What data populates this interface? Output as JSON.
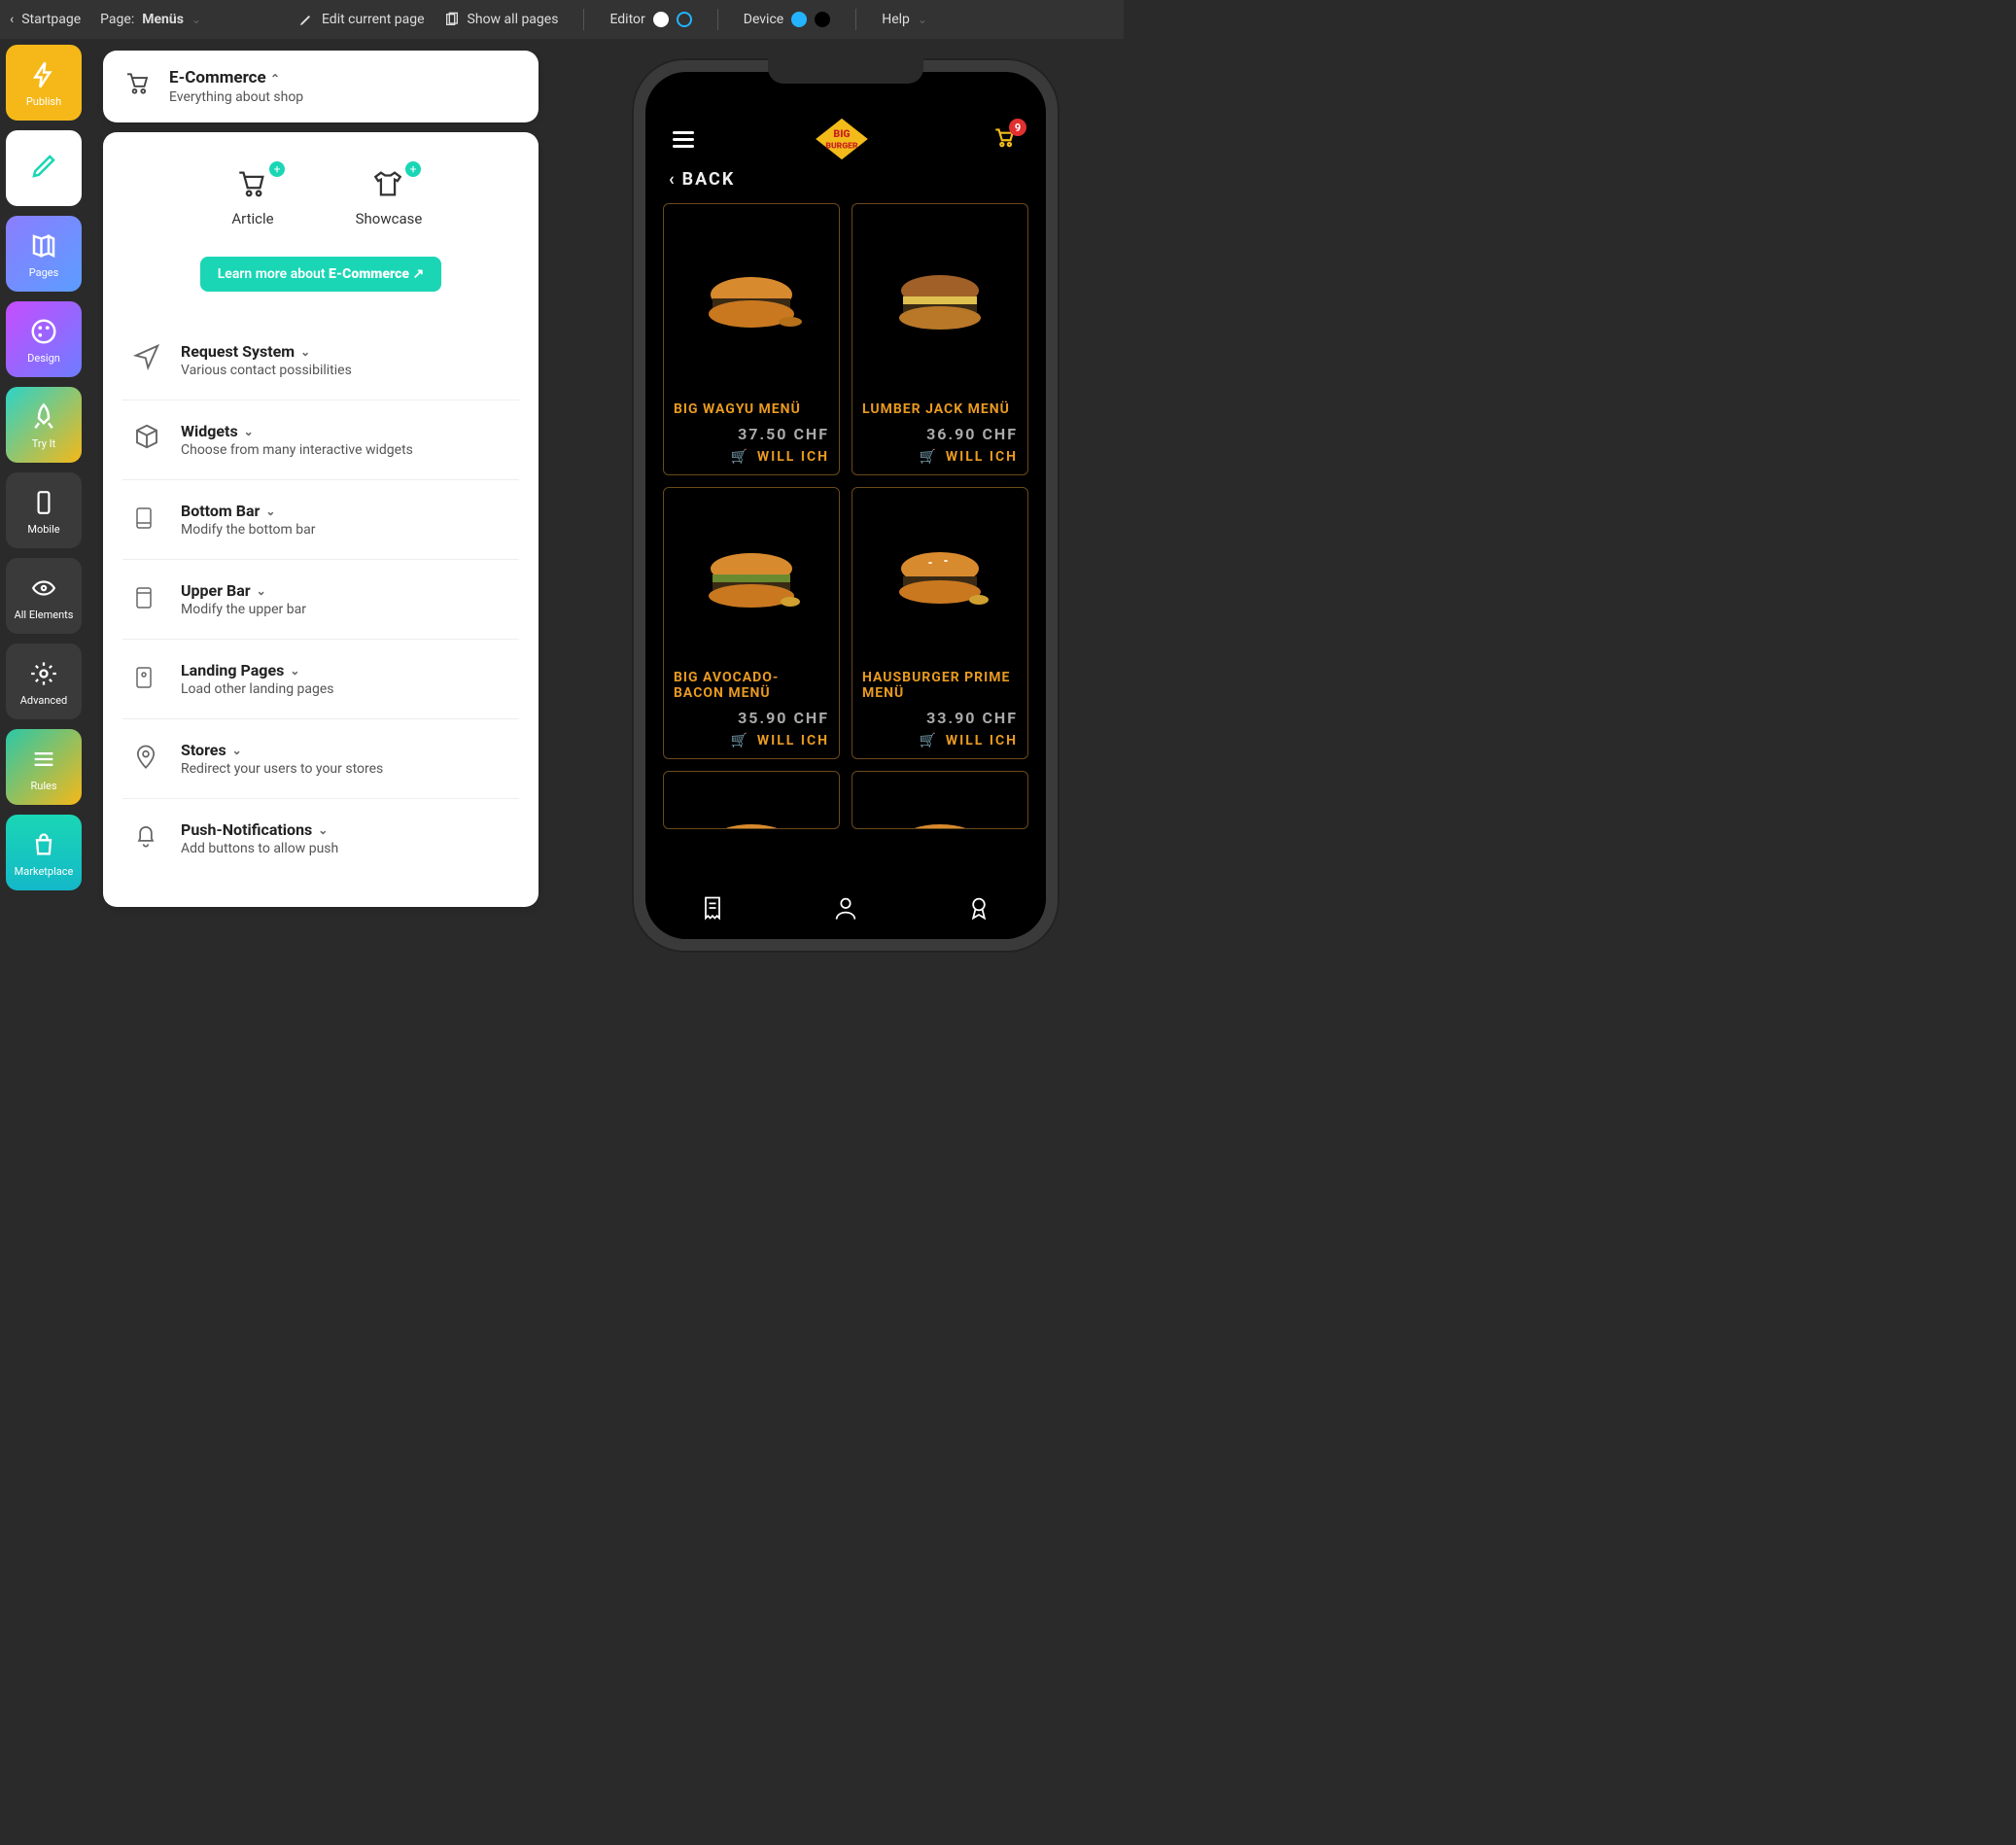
{
  "topbar": {
    "start": "Startpage",
    "page_prefix": "Page:",
    "page_name": "Menüs",
    "edit": "Edit current page",
    "showall": "Show all pages",
    "editor": "Editor",
    "device": "Device",
    "help": "Help"
  },
  "rail": {
    "publish": "Publish",
    "edit": "",
    "pages": "Pages",
    "design": "Design",
    "tryit": "Try It",
    "mobile": "Mobile",
    "allelements": "All Elements",
    "advanced": "Advanced",
    "rules": "Rules",
    "marketplace": "Marketplace"
  },
  "panel": {
    "head": {
      "title": "E-Commerce",
      "sub": "Everything about shop"
    },
    "elements": {
      "article": "Article",
      "showcase": "Showcase"
    },
    "learn_prefix": "Learn more about ",
    "learn_bold": "E-Commerce",
    "sections": [
      {
        "title": "Request System",
        "sub": "Various contact possibilities"
      },
      {
        "title": "Widgets",
        "sub": "Choose from many interactive widgets"
      },
      {
        "title": "Bottom Bar",
        "sub": "Modify the bottom bar"
      },
      {
        "title": "Upper Bar",
        "sub": "Modify the upper bar"
      },
      {
        "title": "Landing Pages",
        "sub": "Load other landing pages"
      },
      {
        "title": "Stores",
        "sub": "Redirect your users to your stores"
      },
      {
        "title": "Push-Notifications",
        "sub": "Add buttons to allow push"
      }
    ]
  },
  "app": {
    "brand_top": "BIG",
    "brand_bottom": "BURGER",
    "cart_count": "9",
    "back": "BACK",
    "willich": "WILL ICH",
    "currency": "CHF",
    "menus": [
      {
        "name": "BIG WAGYU MENÜ",
        "price": "37.50 CHF"
      },
      {
        "name": "LUMBER JACK MENÜ",
        "price": "36.90 CHF"
      },
      {
        "name": "BIG AVOCADO-BACON MENÜ",
        "price": "35.90 CHF"
      },
      {
        "name": "HAUSBURGER PRIME MENÜ",
        "price": "33.90 CHF"
      }
    ]
  }
}
